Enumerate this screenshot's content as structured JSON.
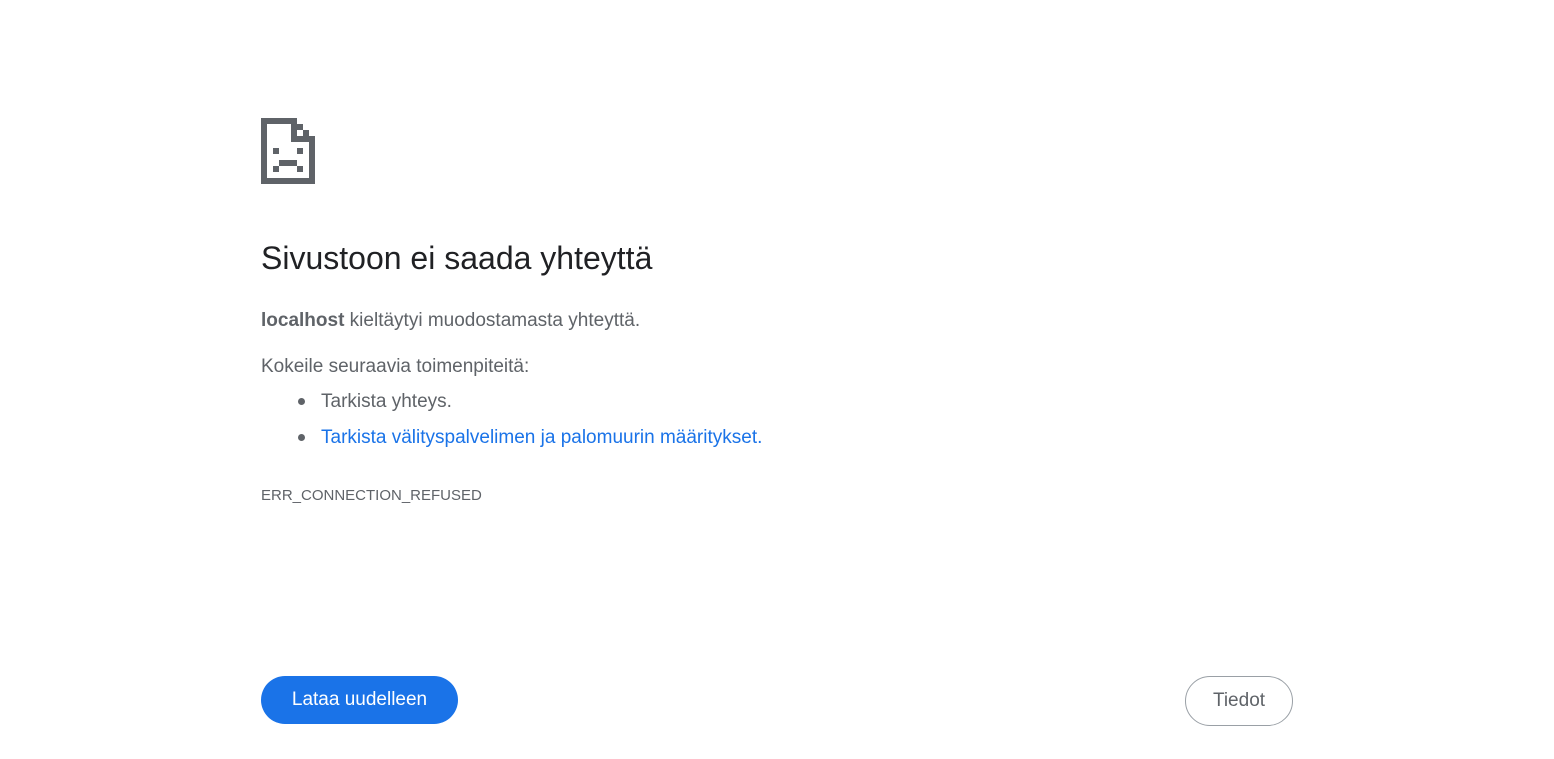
{
  "icon": {
    "name": "sad-page-icon",
    "color": "#5f6368"
  },
  "error": {
    "title": "Sivustoon ei saada yhteyttä",
    "host": "localhost",
    "summary_rest": " kieltäytyi muodostamasta yhteyttä.",
    "suggestions_heading": "Kokeile seuraavia toimenpiteitä:",
    "suggestions": [
      {
        "text": "Tarkista yhteys."
      },
      {
        "link_text": "Tarkista välityspalvelimen ja palomuurin määritykset",
        "after": "."
      }
    ],
    "code": "ERR_CONNECTION_REFUSED"
  },
  "buttons": {
    "reload_label": "Lataa uudelleen",
    "details_label": "Tiedot"
  },
  "colors": {
    "accent": "#1a73e8",
    "title_text": "#202124",
    "body_text": "#5f6368"
  }
}
